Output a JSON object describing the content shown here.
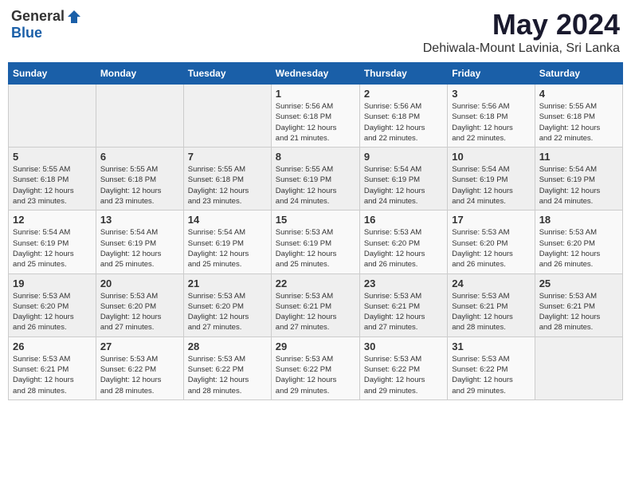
{
  "header": {
    "logo_general": "General",
    "logo_blue": "Blue",
    "month_year": "May 2024",
    "location": "Dehiwala-Mount Lavinia, Sri Lanka"
  },
  "weekdays": [
    "Sunday",
    "Monday",
    "Tuesday",
    "Wednesday",
    "Thursday",
    "Friday",
    "Saturday"
  ],
  "weeks": [
    [
      {
        "day": "",
        "info": ""
      },
      {
        "day": "",
        "info": ""
      },
      {
        "day": "",
        "info": ""
      },
      {
        "day": "1",
        "info": "Sunrise: 5:56 AM\nSunset: 6:18 PM\nDaylight: 12 hours\nand 21 minutes."
      },
      {
        "day": "2",
        "info": "Sunrise: 5:56 AM\nSunset: 6:18 PM\nDaylight: 12 hours\nand 22 minutes."
      },
      {
        "day": "3",
        "info": "Sunrise: 5:56 AM\nSunset: 6:18 PM\nDaylight: 12 hours\nand 22 minutes."
      },
      {
        "day": "4",
        "info": "Sunrise: 5:55 AM\nSunset: 6:18 PM\nDaylight: 12 hours\nand 22 minutes."
      }
    ],
    [
      {
        "day": "5",
        "info": "Sunrise: 5:55 AM\nSunset: 6:18 PM\nDaylight: 12 hours\nand 23 minutes."
      },
      {
        "day": "6",
        "info": "Sunrise: 5:55 AM\nSunset: 6:18 PM\nDaylight: 12 hours\nand 23 minutes."
      },
      {
        "day": "7",
        "info": "Sunrise: 5:55 AM\nSunset: 6:18 PM\nDaylight: 12 hours\nand 23 minutes."
      },
      {
        "day": "8",
        "info": "Sunrise: 5:55 AM\nSunset: 6:19 PM\nDaylight: 12 hours\nand 24 minutes."
      },
      {
        "day": "9",
        "info": "Sunrise: 5:54 AM\nSunset: 6:19 PM\nDaylight: 12 hours\nand 24 minutes."
      },
      {
        "day": "10",
        "info": "Sunrise: 5:54 AM\nSunset: 6:19 PM\nDaylight: 12 hours\nand 24 minutes."
      },
      {
        "day": "11",
        "info": "Sunrise: 5:54 AM\nSunset: 6:19 PM\nDaylight: 12 hours\nand 24 minutes."
      }
    ],
    [
      {
        "day": "12",
        "info": "Sunrise: 5:54 AM\nSunset: 6:19 PM\nDaylight: 12 hours\nand 25 minutes."
      },
      {
        "day": "13",
        "info": "Sunrise: 5:54 AM\nSunset: 6:19 PM\nDaylight: 12 hours\nand 25 minutes."
      },
      {
        "day": "14",
        "info": "Sunrise: 5:54 AM\nSunset: 6:19 PM\nDaylight: 12 hours\nand 25 minutes."
      },
      {
        "day": "15",
        "info": "Sunrise: 5:53 AM\nSunset: 6:19 PM\nDaylight: 12 hours\nand 25 minutes."
      },
      {
        "day": "16",
        "info": "Sunrise: 5:53 AM\nSunset: 6:20 PM\nDaylight: 12 hours\nand 26 minutes."
      },
      {
        "day": "17",
        "info": "Sunrise: 5:53 AM\nSunset: 6:20 PM\nDaylight: 12 hours\nand 26 minutes."
      },
      {
        "day": "18",
        "info": "Sunrise: 5:53 AM\nSunset: 6:20 PM\nDaylight: 12 hours\nand 26 minutes."
      }
    ],
    [
      {
        "day": "19",
        "info": "Sunrise: 5:53 AM\nSunset: 6:20 PM\nDaylight: 12 hours\nand 26 minutes."
      },
      {
        "day": "20",
        "info": "Sunrise: 5:53 AM\nSunset: 6:20 PM\nDaylight: 12 hours\nand 27 minutes."
      },
      {
        "day": "21",
        "info": "Sunrise: 5:53 AM\nSunset: 6:20 PM\nDaylight: 12 hours\nand 27 minutes."
      },
      {
        "day": "22",
        "info": "Sunrise: 5:53 AM\nSunset: 6:21 PM\nDaylight: 12 hours\nand 27 minutes."
      },
      {
        "day": "23",
        "info": "Sunrise: 5:53 AM\nSunset: 6:21 PM\nDaylight: 12 hours\nand 27 minutes."
      },
      {
        "day": "24",
        "info": "Sunrise: 5:53 AM\nSunset: 6:21 PM\nDaylight: 12 hours\nand 28 minutes."
      },
      {
        "day": "25",
        "info": "Sunrise: 5:53 AM\nSunset: 6:21 PM\nDaylight: 12 hours\nand 28 minutes."
      }
    ],
    [
      {
        "day": "26",
        "info": "Sunrise: 5:53 AM\nSunset: 6:21 PM\nDaylight: 12 hours\nand 28 minutes."
      },
      {
        "day": "27",
        "info": "Sunrise: 5:53 AM\nSunset: 6:22 PM\nDaylight: 12 hours\nand 28 minutes."
      },
      {
        "day": "28",
        "info": "Sunrise: 5:53 AM\nSunset: 6:22 PM\nDaylight: 12 hours\nand 28 minutes."
      },
      {
        "day": "29",
        "info": "Sunrise: 5:53 AM\nSunset: 6:22 PM\nDaylight: 12 hours\nand 29 minutes."
      },
      {
        "day": "30",
        "info": "Sunrise: 5:53 AM\nSunset: 6:22 PM\nDaylight: 12 hours\nand 29 minutes."
      },
      {
        "day": "31",
        "info": "Sunrise: 5:53 AM\nSunset: 6:22 PM\nDaylight: 12 hours\nand 29 minutes."
      },
      {
        "day": "",
        "info": ""
      }
    ]
  ]
}
